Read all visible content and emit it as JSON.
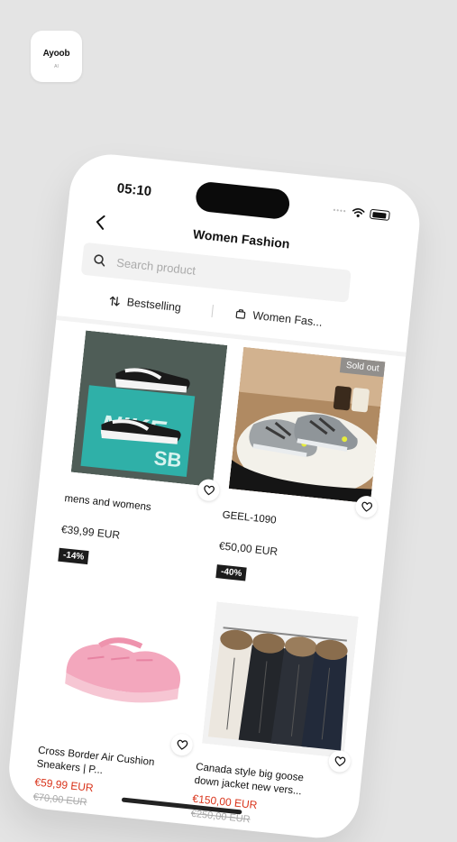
{
  "app": {
    "name": "Ayoob",
    "sub": "AI"
  },
  "status": {
    "time": "05:10",
    "dots": "••••"
  },
  "header": {
    "title": "Women Fashion"
  },
  "search": {
    "placeholder": "Search product"
  },
  "sort": {
    "label": "Bestselling"
  },
  "filter": {
    "label": "Women Fas..."
  },
  "products": [
    {
      "name": "mens and womens",
      "price": "€39,99 EUR",
      "discount": "-14%"
    },
    {
      "name": "GEEL-1090",
      "price": "€50,00 EUR",
      "discount": "-40%",
      "badge": "Sold out"
    },
    {
      "name": "Cross Border Air Cushion Sneakers | P...",
      "price": "€59,99 EUR",
      "original": "€70,00 EUR"
    },
    {
      "name": "Canada style big goose down jacket new vers...",
      "price": "€150,00 EUR",
      "original": "€250,00 EUR"
    }
  ]
}
